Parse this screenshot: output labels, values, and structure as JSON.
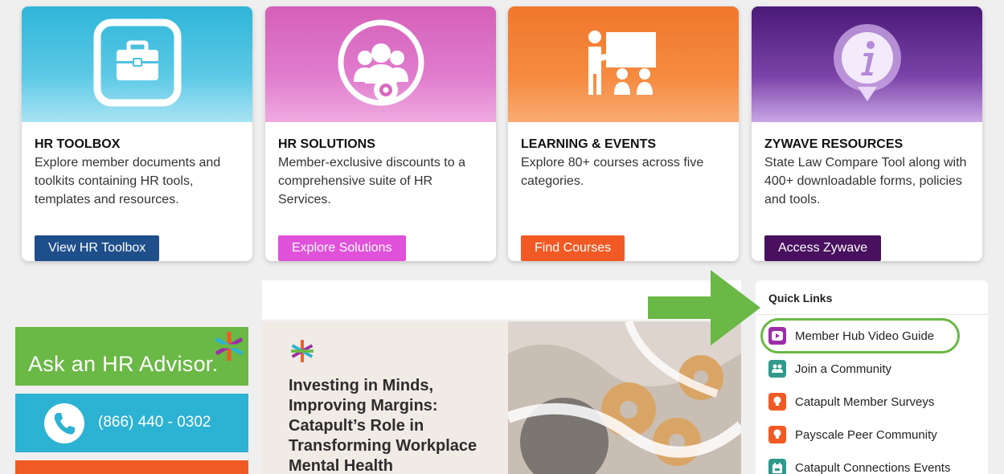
{
  "cards": [
    {
      "title": "HR TOOLBOX",
      "description": "Explore member documents and toolkits containing HR tools, templates and resources.",
      "button": "View HR Toolbox",
      "icon": "toolbox-icon",
      "color": "#1f4f8b"
    },
    {
      "title": "HR SOLUTIONS",
      "description": "Member-exclusive discounts to a comprehensive suite of HR Services.",
      "button": "Explore Solutions",
      "icon": "people-gear-icon",
      "color": "#e052d9"
    },
    {
      "title": "LEARNING & EVENTS",
      "description": "Explore 80+ courses across five categories.",
      "button": "Find Courses",
      "icon": "presentation-icon",
      "color": "#f15a24"
    },
    {
      "title": "ZYWAVE RESOURCES",
      "description": "State Law Compare Tool along with 400+ downloadable forms, policies and tools.",
      "button": "Access Zywave",
      "icon": "info-pin-icon",
      "color": "#48105f"
    }
  ],
  "sidebar": {
    "advisor_label": "Ask an HR Advisor.",
    "phone_number": "(866) 440 - 0302"
  },
  "feature": {
    "headline": "Investing in Minds, Improving Margins: Catapult’s Role in Transforming Workplace Mental Health"
  },
  "quick_links": {
    "title": "Quick Links",
    "items": [
      {
        "label": "Member Hub Video Guide",
        "icon": "video-play-icon",
        "color": "#9b2fa8"
      },
      {
        "label": "Join a Community",
        "icon": "community-icon",
        "color": "#2f9a8c"
      },
      {
        "label": "Catapult Member Surveys",
        "icon": "lightbulb-icon",
        "color": "#f15a24"
      },
      {
        "label": "Payscale Peer Community",
        "icon": "lightbulb-icon",
        "color": "#f15a24"
      },
      {
        "label": "Catapult Connections Events",
        "icon": "calendar-icon",
        "color": "#2f9a8c"
      }
    ]
  }
}
